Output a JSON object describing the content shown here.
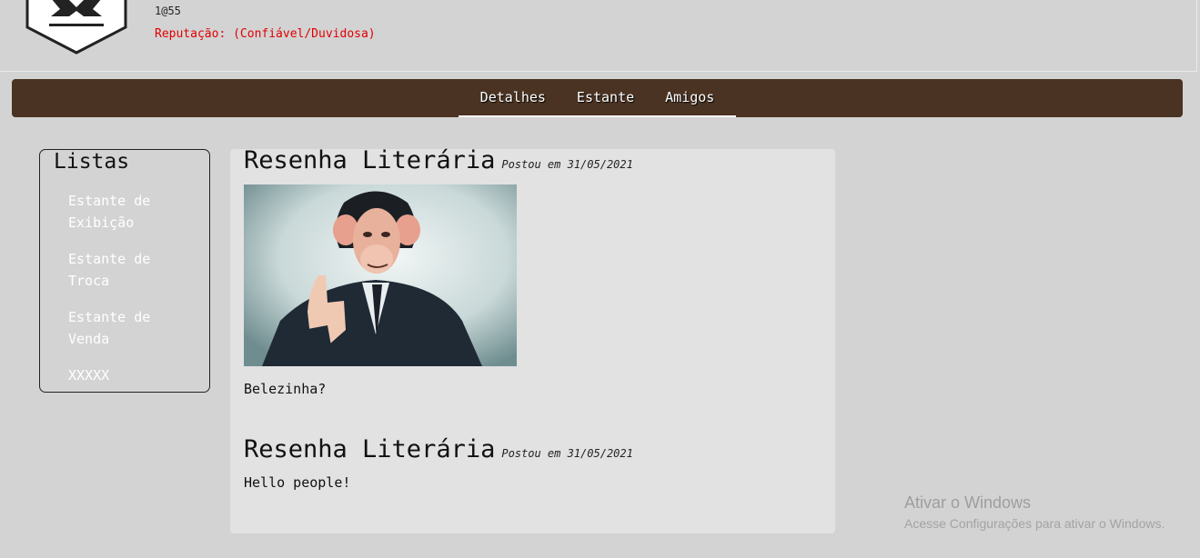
{
  "header": {
    "user_code": "1@55",
    "reputation": "Reputação: (Confiável/Duvidosa)"
  },
  "nav": {
    "tabs": [
      {
        "label": "Detalhes"
      },
      {
        "label": "Estante"
      },
      {
        "label": "Amigos"
      }
    ]
  },
  "sidebar": {
    "title": "Listas",
    "items": [
      {
        "label": "Estante de Exibição"
      },
      {
        "label": "Estante de Troca"
      },
      {
        "label": "Estante de Venda"
      },
      {
        "label": "XXXXX"
      }
    ]
  },
  "posts": [
    {
      "title": "Resenha Literária",
      "date": "Postou em 31/05/2021",
      "text": "Belezinha?"
    },
    {
      "title": "Resenha Literária",
      "date": "Postou em 31/05/2021",
      "text": "Hello people!"
    }
  ],
  "watermark": {
    "title": "Ativar o Windows",
    "subtitle": "Acesse Configurações para ativar o Windows."
  },
  "colors": {
    "navbar": "#4a3322",
    "reputation": "#e00000",
    "background": "#d3d3d3",
    "panel": "#e2e2e2"
  }
}
